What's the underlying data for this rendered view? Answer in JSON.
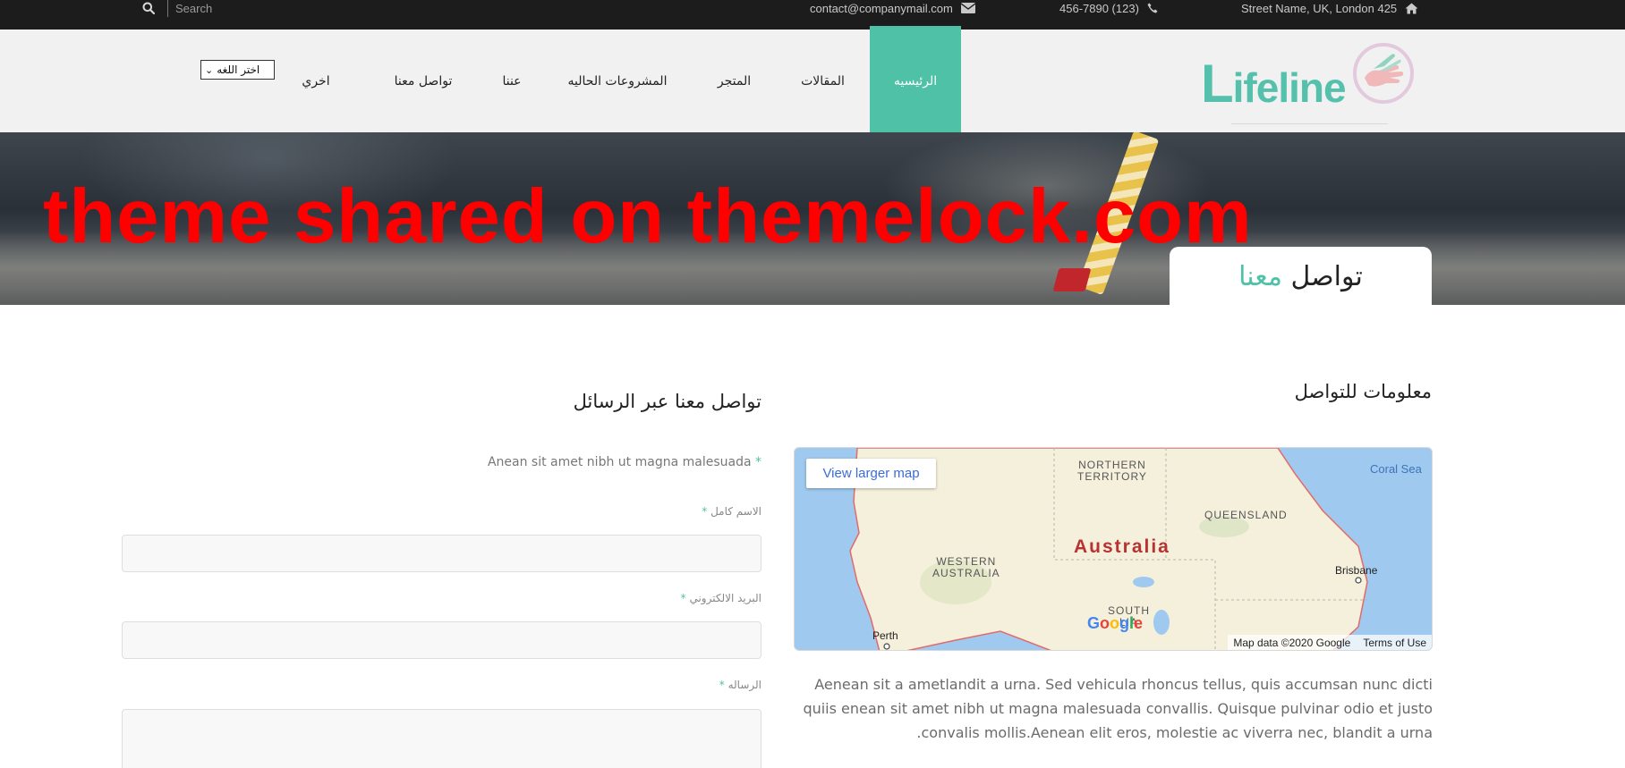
{
  "topbar": {
    "search_placeholder": "Search",
    "email": "contact@companymail.com",
    "phone": "456-7890 (123)",
    "address": "Street Name, UK, London 425",
    "icons": [
      "search-icon",
      "envelope-icon",
      "phone-icon",
      "home-icon"
    ]
  },
  "header": {
    "language_select": "اختر اللغه",
    "logo_text_initial": "L",
    "logo_text_rest": "ifeline",
    "nav": [
      {
        "label": "الرئيسيه",
        "active": true
      },
      {
        "label": "المقالات",
        "active": false
      },
      {
        "label": "المتجر",
        "active": false
      },
      {
        "label": "المشروعات الحاليه",
        "active": false
      },
      {
        "label": "عننا",
        "active": false
      },
      {
        "label": "تواصل معنا",
        "active": false
      },
      {
        "label": "اخري",
        "active": false
      }
    ]
  },
  "banner": {
    "watermark": "theme shared on themelock.com",
    "page_title_main": "تواصل",
    "page_title_accent": "معنا"
  },
  "contact_info": {
    "title": "معلومات للتواصل",
    "map": {
      "view_larger": "View larger map",
      "region_northern_territory": "NORTHERN\nTERRITORY",
      "region_queensland": "QUEENSLAND",
      "region_western_australia": "WESTERN\nAUSTRALIA",
      "region_south_australia": "SOUTH\nLIA",
      "country": "Australia",
      "city_brisbane": "Brisbane",
      "city_perth": "Perth",
      "sea": "Coral Sea",
      "google_logo": "Google",
      "attribution": "Map data ©2020 Google",
      "terms": "Terms of Use"
    },
    "paragraph": "Aenean sit a ametlandit a urna. Sed vehicula rhoncus tellus, quis accumsan nunc dicti quiis enean sit amet nibh ut magna malesuada convallis. Quisque pulvinar odio et justo convalis mollis.Aenean elit eros, molestie ac viverra nec, blandit a urna."
  },
  "contact_form": {
    "title": "تواصل معنا عبر الرسائل",
    "intro": "Anean sit amet nibh ut magna malesuada",
    "required_mark": "*",
    "fields": [
      {
        "label": "الاسم كامل",
        "value": ""
      },
      {
        "label": "البريد الالكتروني",
        "value": ""
      },
      {
        "label": "الرساله",
        "value": ""
      }
    ]
  },
  "colors": {
    "accent": "#4fc1a7",
    "topbar_bg": "#1c1c1c",
    "header_bg": "#f1f1f1",
    "watermark": "#ff0000"
  }
}
